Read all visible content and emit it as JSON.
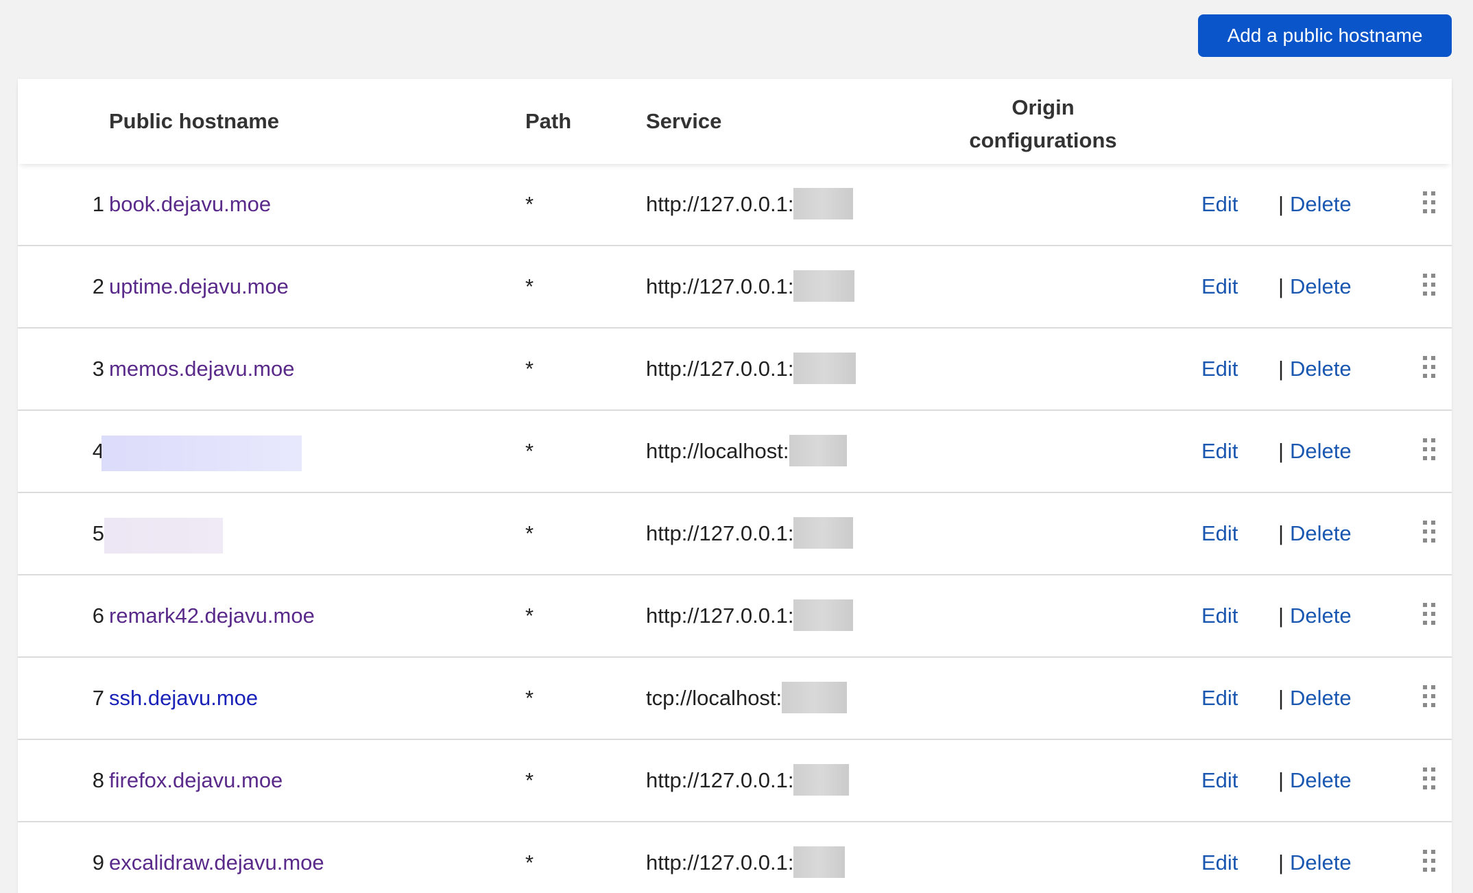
{
  "toolbar": {
    "add_label": "Add a public hostname"
  },
  "table": {
    "headers": {
      "number": "",
      "hostname": "Public hostname",
      "path": "Path",
      "service": "Service",
      "origin_line1": "Origin",
      "origin_line2": "configurations"
    },
    "actions": {
      "edit": "Edit",
      "separator": "|",
      "delete": "Delete"
    },
    "rows": [
      {
        "number": "1",
        "hostname": "book.dejavu.moe",
        "path": "*",
        "service": "http://127.0.0.1:"
      },
      {
        "number": "2",
        "hostname": "uptime.dejavu.moe",
        "path": "*",
        "service": "http://127.0.0.1:"
      },
      {
        "number": "3",
        "hostname": "memos.dejavu.moe",
        "path": "*",
        "service": "http://127.0.0.1:"
      },
      {
        "number": "4",
        "hostname": "",
        "path": "*",
        "service": "http://localhost:"
      },
      {
        "number": "5",
        "hostname": "",
        "path": "*",
        "service": "http://127.0.0.1:"
      },
      {
        "number": "6",
        "hostname": "remark42.dejavu.moe",
        "path": "*",
        "service": "http://127.0.0.1:"
      },
      {
        "number": "7",
        "hostname": "ssh.dejavu.moe",
        "path": "*",
        "service": "tcp://localhost:"
      },
      {
        "number": "8",
        "hostname": "firefox.dejavu.moe",
        "path": "*",
        "service": "http://127.0.0.1:"
      },
      {
        "number": "9",
        "hostname": "excalidraw.dejavu.moe",
        "path": "*",
        "service": "http://127.0.0.1:"
      }
    ]
  },
  "icons": {
    "drag": "drag-handle-icon"
  },
  "colors": {
    "primary_button": "#0a55c9",
    "visited_link": "#5a2a8a",
    "link": "#1a22b8",
    "action_link": "#1a57b0"
  }
}
